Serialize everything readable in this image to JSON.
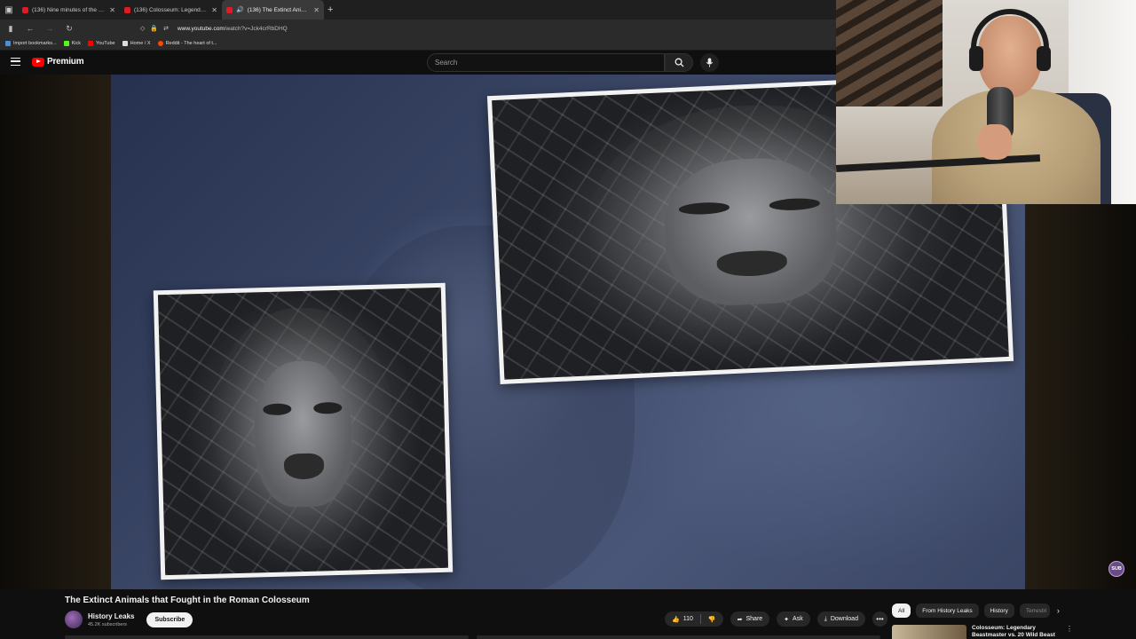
{
  "browser": {
    "tabs": [
      {
        "title": "(136) Nine minutes of the crazi",
        "active": false,
        "audio": false
      },
      {
        "title": "(136) Colosseum: Legendary Be",
        "active": false,
        "audio": false
      },
      {
        "title": "(136) The Extinct Animals t",
        "active": true,
        "audio": true
      }
    ],
    "new_tab_icon": "+",
    "url_host": "www.youtube.com",
    "url_path": "/watch?v=Jck4crRbDHQ",
    "bookmarks": [
      {
        "label": "Import bookmarks...",
        "color": "#4a90d9"
      },
      {
        "label": "Kick",
        "color": "#53fc18"
      },
      {
        "label": "YouTube",
        "color": "#ff0000"
      },
      {
        "label": "Home / X",
        "color": "#dddddd"
      },
      {
        "label": "Reddit - The heart of t...",
        "color": "#ff4500"
      }
    ]
  },
  "youtube": {
    "logo_text": "Premium",
    "search_placeholder": "Search"
  },
  "video": {
    "title": "The Extinct Animals that Fought in the Roman Colosseum",
    "channel_name": "History Leaks",
    "subscribers": "45.2K subscribers",
    "subscribe_label": "Subscribe",
    "like_count": "110",
    "share_label": "Share",
    "ask_label": "Ask",
    "download_label": "Download",
    "watermark": "SUB"
  },
  "chips": {
    "items": [
      "All",
      "From History Leaks",
      "History",
      "Terrestri"
    ],
    "selected": "All"
  },
  "recommendation": {
    "title": "Colosseum: Legendary Beastmaster vs. 20 Wild Beast"
  },
  "colors": {
    "youtube_red": "#ff0000",
    "background": "#0f0f0f",
    "chip_bg": "#272727"
  }
}
